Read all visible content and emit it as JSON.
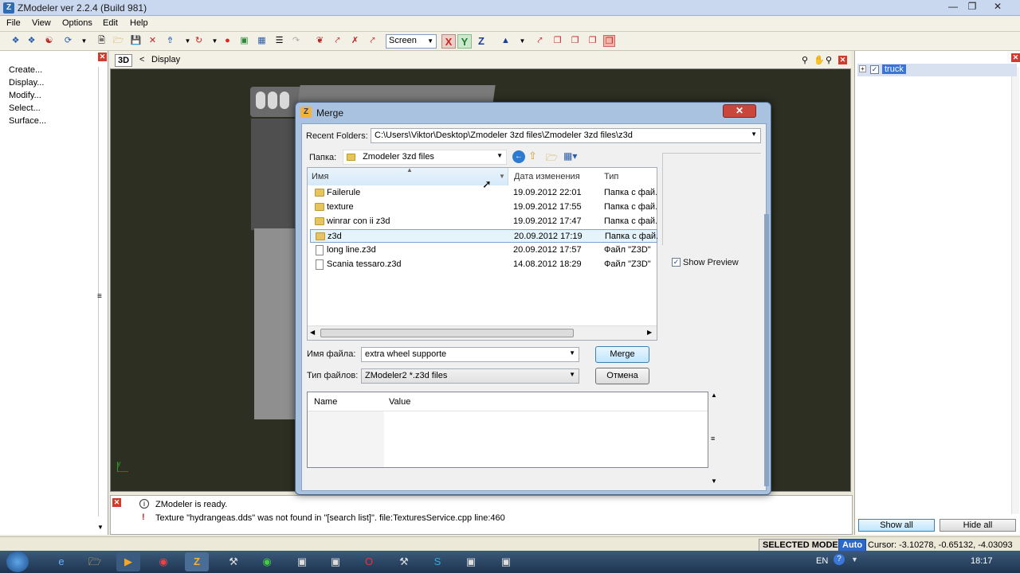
{
  "window": {
    "title": "ZModeler ver 2.2.4 (Build 981)",
    "app_icon": "Z"
  },
  "menu": [
    "File",
    "View",
    "Options",
    "Edit",
    "Help"
  ],
  "toolbar": {
    "view_mode": "Screen",
    "axes": [
      "X",
      "Y",
      "Z"
    ]
  },
  "left_panel": {
    "commands": [
      "Create...",
      "Display...",
      "Modify...",
      "Select...",
      "Surface..."
    ]
  },
  "viewport": {
    "mode_label": "3D",
    "nav_arrow": "<",
    "breadcrumb": "Display"
  },
  "right_panel": {
    "tree_item": "truck",
    "show_all": "Show all",
    "hide_all": "Hide all"
  },
  "log": {
    "messages": [
      {
        "icon": "info",
        "text": "ZModeler is ready."
      },
      {
        "icon": "warning",
        "text": "Texture \"hydrangeas.dds\" was not found in \"[search list]\". file:TexturesService.cpp line:460"
      }
    ]
  },
  "status": {
    "mode": "SELECTED MODE",
    "auto": "Auto",
    "cursor": "Cursor: -3.10278, -0.65132, -4.03093"
  },
  "taskbar": {
    "lang": "EN",
    "time": "18:17"
  },
  "dialog": {
    "title": "Merge",
    "recent_label": "Recent Folders:",
    "recent_value": "C:\\Users\\Viktor\\Desktop\\Zmodeler 3zd files\\Zmodeler 3zd files\\z3d",
    "folder_label": "Папка:",
    "folder_value": "Zmodeler 3zd files",
    "columns": {
      "name": "Имя",
      "date": "Дата изменения",
      "type": "Тип"
    },
    "files": [
      {
        "name": "Failerule",
        "date": "19.09.2012 22:01",
        "type": "Папка с фай...",
        "kind": "folder"
      },
      {
        "name": "texture",
        "date": "19.09.2012 17:55",
        "type": "Папка с фай...",
        "kind": "folder"
      },
      {
        "name": "winrar con ii z3d",
        "date": "19.09.2012 17:47",
        "type": "Папка с фай...",
        "kind": "folder"
      },
      {
        "name": "z3d",
        "date": "20.09.2012 17:19",
        "type": "Папка с фай...",
        "kind": "folder"
      },
      {
        "name": "long line.z3d",
        "date": "20.09.2012 17:57",
        "type": "Файл \"Z3D\"",
        "kind": "file"
      },
      {
        "name": "Scania tessaro.z3d",
        "date": "14.08.2012 18:29",
        "type": "Файл \"Z3D\"",
        "kind": "file"
      }
    ],
    "filename_label": "Имя файла:",
    "filename_value": "extra wheel supporte",
    "filetype_label": "Тип файлов:",
    "filetype_value": "ZModeler2 *.z3d files",
    "merge_button": "Merge",
    "cancel_button": "Отмена",
    "show_preview": "Show Preview",
    "props": {
      "name_col": "Name",
      "value_col": "Value"
    }
  }
}
